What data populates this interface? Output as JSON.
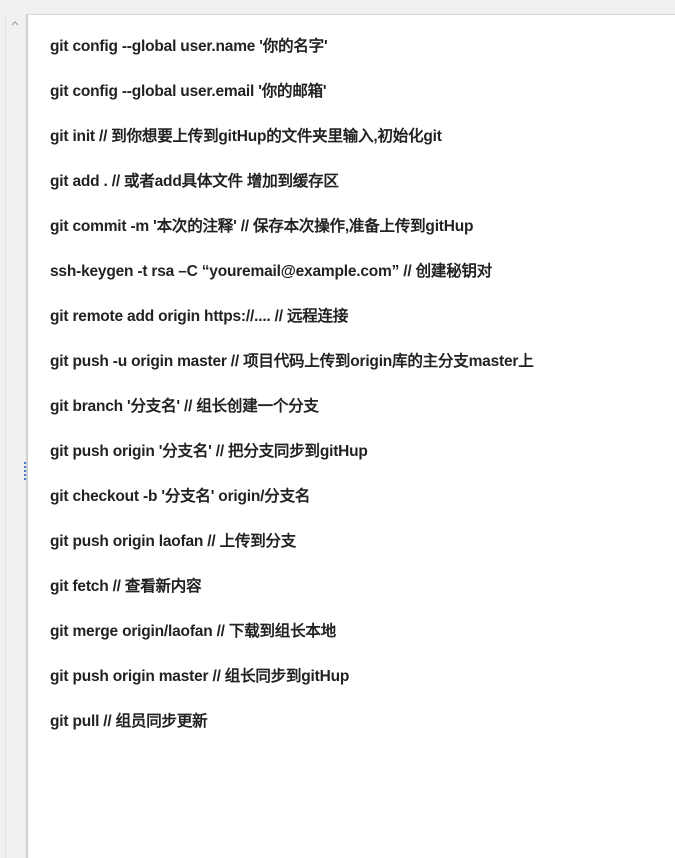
{
  "editor": {
    "lines": [
      "git config --global user.name '你的名字'",
      "git config --global user.email '你的邮箱'",
      "git init // 到你想要上传到gitHup的文件夹里输入,初始化git",
      "git add . // 或者add具体文件 增加到缓存区",
      "git commit -m '本次的注释' // 保存本次操作,准备上传到gitHup",
      "ssh-keygen  -t rsa –C “youremail@example.com” // 创建秘钥对",
      "git remote add origin https://.... // 远程连接",
      "git push -u origin master // 项目代码上传到origin库的主分支master上",
      "git branch '分支名' // 组长创建一个分支",
      "git push origin '分支名' // 把分支同步到gitHup",
      "git checkout -b '分支名' origin/分支名",
      "git push origin laofan // 上传到分支",
      "git fetch // 查看新内容",
      "git merge origin/laofan // 下载到组长本地",
      "git push origin master // 组长同步到gitHup",
      "git pull // 组员同步更新"
    ]
  },
  "icons": {
    "scroll_up": "chevron-up-icon",
    "splitter": "splitter-grip-icon"
  },
  "colors": {
    "text": "#222222",
    "gutter": "#f0f0f0",
    "grip": "#4a78c2"
  }
}
